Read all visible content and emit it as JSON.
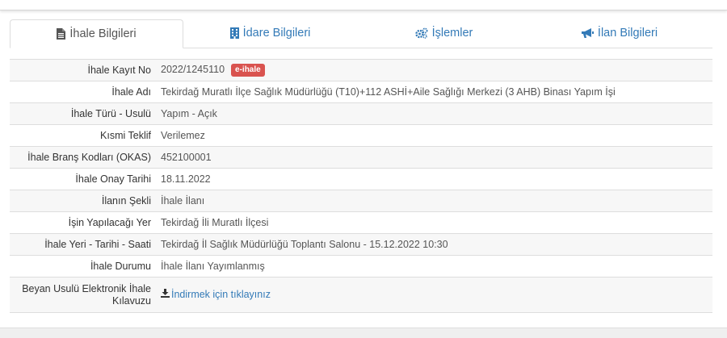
{
  "tabs": [
    {
      "label": "İhale Bilgileri",
      "icon": "file-text-icon",
      "active": true
    },
    {
      "label": "İdare Bilgileri",
      "icon": "building-icon",
      "active": false
    },
    {
      "label": "İşlemler",
      "icon": "gears-icon",
      "active": false
    },
    {
      "label": "İlan Bilgileri",
      "icon": "bullhorn-icon",
      "active": false
    }
  ],
  "details": {
    "kayit_no": {
      "label": "İhale Kayıt No",
      "value": "2022/1245110",
      "badge": "e-ihale"
    },
    "adi": {
      "label": "İhale Adı",
      "value": "Tekirdağ Muratlı İlçe Sağlık Müdürlüğü (T10)+112 ASHİ+Aile Sağlığı Merkezi (3 AHB) Binası Yapım İşi"
    },
    "turu": {
      "label": "İhale Türü - Usulü",
      "value": "Yapım - Açık"
    },
    "kismi": {
      "label": "Kısmi Teklif",
      "value": "Verilemez"
    },
    "okas": {
      "label": "İhale Branş Kodları (OKAS)",
      "value": "452100001"
    },
    "onay": {
      "label": "İhale Onay Tarihi",
      "value": "18.11.2022"
    },
    "sekli": {
      "label": "İlanın Şekli",
      "value": "İhale İlanı"
    },
    "yer": {
      "label": "İşin Yapılacağı Yer",
      "value": "Tekirdağ İli Muratlı İlçesi"
    },
    "yer_tarih": {
      "label": "İhale Yeri - Tarihi - Saati",
      "value": "Tekirdağ İl Sağlık Müdürlüğü Toplantı Salonu - 15.12.2022 10:30"
    },
    "durum": {
      "label": "İhale Durumu",
      "value": "İhale İlanı Yayımlanmış"
    },
    "kilavuz": {
      "label": "Beyan Usulü Elektronik İhale Kılavuzu",
      "link": "İndirmek için tıklayınız",
      "icon": "download-icon"
    }
  },
  "colors": {
    "link": "#337ab7",
    "badge": "#d9534f",
    "stripe": "#f7f7f7",
    "border": "#dddddd"
  }
}
